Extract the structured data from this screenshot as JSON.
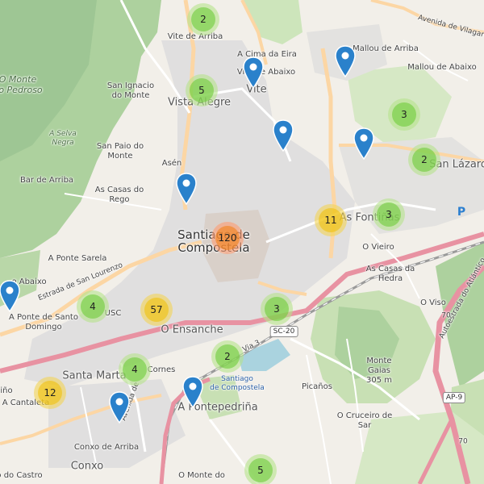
{
  "map": {
    "labels": {
      "vite_de_arriba": "Vite de Arriba",
      "mallou_de_arriba": "Mallou de Arriba",
      "mallou_de_abaixo": "Mallou de Abaixo",
      "a_cima_da_eira": "A Cima da Eira",
      "vite_de_abaixo": "Vite de Abaixo",
      "vite": "Vite",
      "vista_alegre": "Vista Alegre",
      "san_ignacio": "San Ignacio\ndo Monte",
      "o_monte_pedroso": "O Monte\ndo Pedroso",
      "a_selva_negra": "A Selva\nNegra",
      "san_paio_do_monte": "San Paio do\nMonte",
      "asen": "Asén",
      "as_casas_do_rego": "As Casas do\nRego",
      "bar_de_arriba": "Bar de Arriba",
      "santiago_de_compostela": "Santiago de\nCompostela",
      "as_fontinas": "As Fontiñas",
      "san_lazaro": "San Lázaro",
      "o_vieiro": "O Vieiro",
      "as_casas_da_hedra": "As Casas da\nHedra",
      "o_viso": "O Viso",
      "a_ponte_sarela": "A Ponte Sarela",
      "estrada_san_lourenzo": "Estrada de San Lourenzo",
      "o_abaixo": "o Abaixo",
      "a_ponte_de_santo_domingo": "A Ponte de Santo\nDomingo",
      "usc": "USC",
      "o_ensanche": "O Ensanche",
      "sc20": "SC-20",
      "via3": "Via 3",
      "monte_gaias": "Monte\nGaias\n305 m",
      "santa_marta": "Santa Marta",
      "cornes": "Cornes",
      "estacion": "Santiago\nde Compostela",
      "a_pontepedrina": "A Pontepedriña",
      "picanos": "Picaños",
      "o_cruceiro_de_sar": "O Cruceiro de\nSar",
      "ap9": "AP-9",
      "a_cantaleta": "A Cantaleta",
      "conxo_de_arriba": "Conxo de Arriba",
      "conxo": "Conxo",
      "o_monte_do": "O Monte do",
      "o_do_castro": "o do Castro",
      "avenida_de": "Avenida de",
      "autoestrada": "Autoestrada do Atlántico",
      "avenida_vilagarcia": "Avenida de Vilagarcía",
      "ino": "iño",
      "n70": "70",
      "n70b": "70",
      "parking": "P"
    },
    "clusters": [
      {
        "id": "c1",
        "count": "2",
        "size": "small"
      },
      {
        "id": "c2",
        "count": "5",
        "size": "small"
      },
      {
        "id": "c3",
        "count": "3",
        "size": "small"
      },
      {
        "id": "c4",
        "count": "2",
        "size": "small"
      },
      {
        "id": "c5",
        "count": "11",
        "size": "medium"
      },
      {
        "id": "c6",
        "count": "3",
        "size": "small"
      },
      {
        "id": "c7",
        "count": "120",
        "size": "large"
      },
      {
        "id": "c8",
        "count": "4",
        "size": "small"
      },
      {
        "id": "c9",
        "count": "57",
        "size": "medium"
      },
      {
        "id": "c10",
        "count": "3",
        "size": "small"
      },
      {
        "id": "c11",
        "count": "2",
        "size": "small"
      },
      {
        "id": "c12",
        "count": "4",
        "size": "small"
      },
      {
        "id": "c13",
        "count": "12",
        "size": "medium"
      },
      {
        "id": "c14",
        "count": "5",
        "size": "small"
      }
    ],
    "marker_color": "#2a81cb",
    "marker_icon": "map-pin-icon"
  }
}
